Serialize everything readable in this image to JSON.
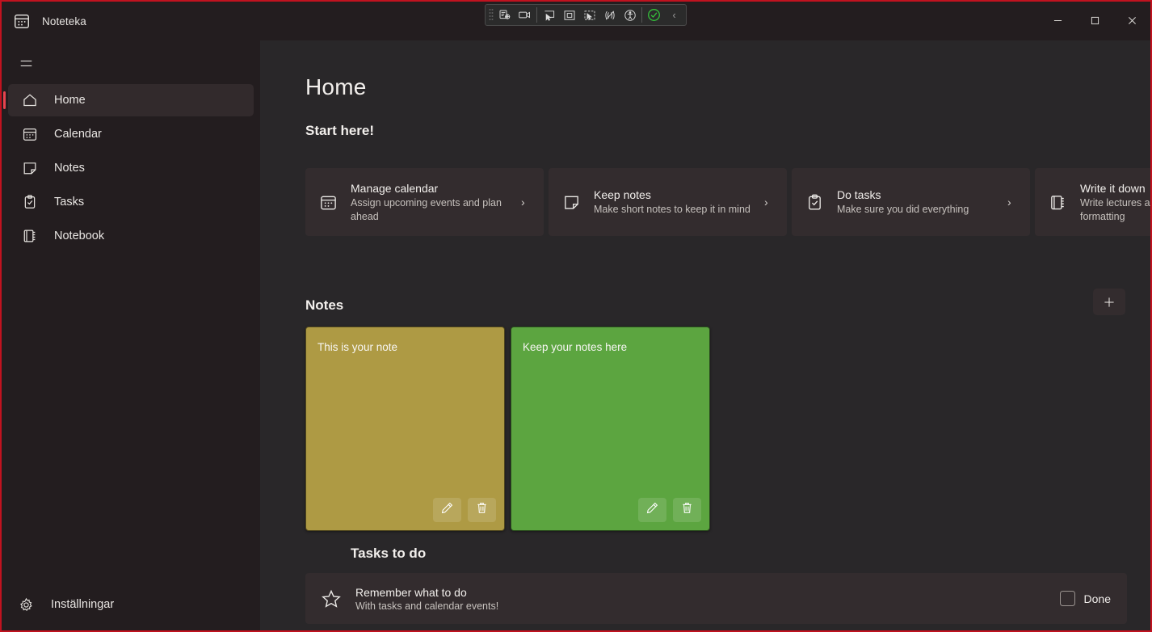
{
  "window": {
    "app_title": "Noteteka",
    "app_icon": "calendar-app-icon",
    "minimize_label": "—",
    "maximize_label": "□",
    "close_label": "✕"
  },
  "capture_toolbar": {
    "buttons": [
      {
        "name": "capture-settings-icon",
        "label": ""
      },
      {
        "name": "record-video-icon",
        "label": ""
      },
      {
        "name": "select-pointer-icon",
        "label": ""
      },
      {
        "name": "select-region-icon",
        "label": ""
      },
      {
        "name": "select-element-icon",
        "label": ""
      },
      {
        "name": "no-motion-icon",
        "label": ""
      },
      {
        "name": "accessibility-icon",
        "label": ""
      },
      {
        "name": "status-ok-icon",
        "label": ""
      }
    ],
    "collapse_label": "‹",
    "accent_ok_color": "#35c23b"
  },
  "sidebar": {
    "menu_icon": "hamburger-icon",
    "items": [
      {
        "label": "Home",
        "icon": "home-icon",
        "active": true
      },
      {
        "label": "Calendar",
        "icon": "calendar-icon",
        "active": false
      },
      {
        "label": "Notes",
        "icon": "note-icon",
        "active": false
      },
      {
        "label": "Tasks",
        "icon": "clipboard-check-icon",
        "active": false
      },
      {
        "label": "Notebook",
        "icon": "notebook-icon",
        "active": false
      }
    ],
    "settings": {
      "label": "Inställningar",
      "icon": "gear-icon"
    },
    "accent_color": "#e8434e",
    "background_color": "#231d1f"
  },
  "main": {
    "page_title": "Home",
    "start_section_title": "Start here!",
    "start_cards": [
      {
        "title": "Manage calendar",
        "subtitle": "Assign upcoming events and plan ahead",
        "icon": "calendar-icon",
        "arrow": "›"
      },
      {
        "title": "Keep notes",
        "subtitle": "Make short notes to keep it in mind",
        "icon": "note-icon",
        "arrow": "›"
      },
      {
        "title": "Do tasks",
        "subtitle": "Make sure you did everything",
        "icon": "clipboard-check-icon",
        "arrow": "›"
      },
      {
        "title": "Write it down",
        "subtitle": "Write lectures and texts with formatting",
        "icon": "notebook-icon",
        "arrow": "›"
      }
    ],
    "notes_section_title": "Notes",
    "add_note_label": "+",
    "notes": [
      {
        "text": "This is your note",
        "color": "#ae9a44",
        "edit_icon": "pencil-icon",
        "delete_icon": "trash-icon"
      },
      {
        "text": "Keep your notes here",
        "color": "#5ca540",
        "edit_icon": "pencil-icon",
        "delete_icon": "trash-icon"
      }
    ],
    "tasks_section_title": "Tasks to do",
    "tasks": [
      {
        "title": "Remember what to do",
        "subtitle": "With tasks and calendar events!",
        "icon": "star-icon",
        "done_label": "Done",
        "done": false
      }
    ]
  }
}
